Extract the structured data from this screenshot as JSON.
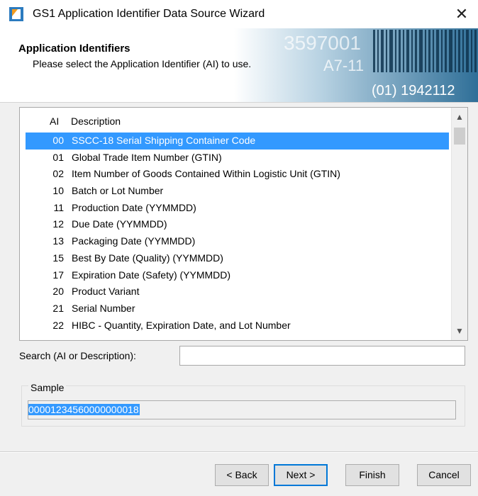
{
  "window": {
    "title": "GS1 Application Identifier Data Source Wizard",
    "close_glyph": "✕"
  },
  "banner": {
    "title": "Application Identifiers",
    "subtitle": "Please select the Application Identifier (AI) to use.",
    "art_text_1": "3597001",
    "art_text_2": "A7-11",
    "art_text_3": "(01) 1942112"
  },
  "list": {
    "columns": [
      "AI",
      "Description"
    ],
    "rows": [
      {
        "ai": "00",
        "desc": "SSCC-18 Serial Shipping Container Code",
        "selected": true
      },
      {
        "ai": "01",
        "desc": "Global Trade Item Number (GTIN)"
      },
      {
        "ai": "02",
        "desc": "Item Number of Goods Contained Within Logistic Unit (GTIN)"
      },
      {
        "ai": "10",
        "desc": "Batch or Lot Number"
      },
      {
        "ai": "11",
        "desc": "Production Date (YYMMDD)"
      },
      {
        "ai": "12",
        "desc": "Due Date (YYMMDD)"
      },
      {
        "ai": "13",
        "desc": "Packaging Date (YYMMDD)"
      },
      {
        "ai": "15",
        "desc": "Best By Date (Quality) (YYMMDD)"
      },
      {
        "ai": "17",
        "desc": "Expiration Date (Safety) (YYMMDD)"
      },
      {
        "ai": "20",
        "desc": "Product Variant"
      },
      {
        "ai": "21",
        "desc": "Serial Number"
      },
      {
        "ai": "22",
        "desc": "HIBC - Quantity, Expiration Date, and Lot Number"
      }
    ]
  },
  "search": {
    "label": "Search (AI or Description):",
    "value": ""
  },
  "sample": {
    "legend": "Sample",
    "value": "00001234560000000018"
  },
  "buttons": {
    "back": "< Back",
    "next": "Next >",
    "finish": "Finish",
    "cancel": "Cancel"
  },
  "colors": {
    "selection": "#3399ff",
    "default_button_border": "#0078d7"
  }
}
